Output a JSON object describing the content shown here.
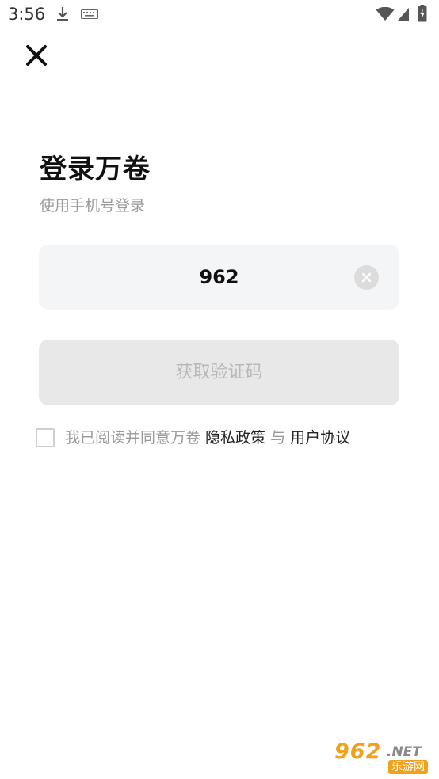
{
  "status_bar": {
    "time": "3:56",
    "icons": [
      "download-icon",
      "keyboard-icon",
      "wifi-icon",
      "signal-icon",
      "battery-icon"
    ]
  },
  "close": {
    "icon": "close-icon"
  },
  "header": {
    "title": "登录万卷",
    "subtitle": "使用手机号登录"
  },
  "phone_field": {
    "value": "962",
    "clear_icon": "clear-circle-icon"
  },
  "get_code_button": {
    "label": "获取验证码",
    "enabled": false
  },
  "agreement": {
    "checked": false,
    "prefix": "我已阅读并同意万卷 ",
    "privacy_link": "隐私政策",
    "connector": " 与 ",
    "terms_link": "用户协议"
  },
  "watermark": {
    "main": "962",
    "suffix": ".NET",
    "sub": "乐游网"
  },
  "colors": {
    "field_bg": "#f4f5f7",
    "button_disabled_bg": "#e8e8e8",
    "button_disabled_text": "#b8b8b8",
    "muted_text": "#9a9a9a",
    "watermark_orange": "#f0a11e"
  }
}
